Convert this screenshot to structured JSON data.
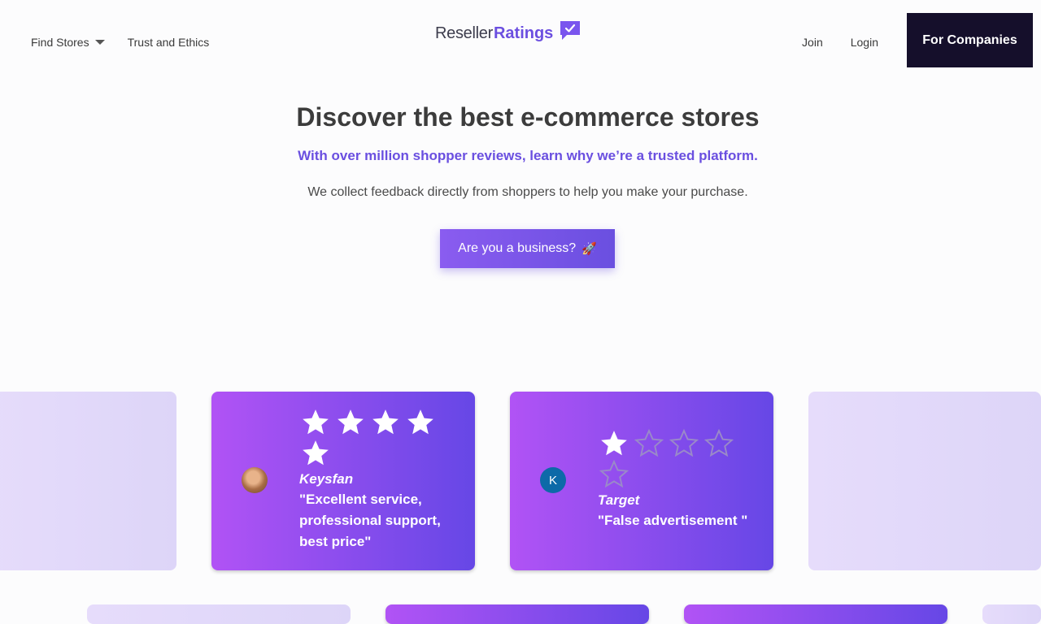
{
  "header": {
    "nav_left": [
      {
        "label": "Find Stores"
      },
      {
        "label": "Trust and Ethics"
      }
    ],
    "logo": {
      "part1": "Reseller",
      "part2": "Ratings"
    },
    "join_label": "Join",
    "login_label": "Login",
    "companies_label": "For Companies"
  },
  "hero": {
    "title": "Discover the best e-commerce stores",
    "subtitle": "With over million shopper reviews, learn why we’re a trusted platform.",
    "description": "We collect feedback directly from shoppers to help you make your purchase.",
    "cta_label": "Are you a business?",
    "cta_emoji": "🚀"
  },
  "reviews": [
    {
      "reviewer": "Keysfan",
      "rating": 5,
      "quote": "\"Excellent service, professional support, best price\""
    },
    {
      "reviewer": "Target",
      "rating": 1,
      "avatar_letter": "K",
      "quote": "\"False advertisement \""
    }
  ],
  "colors": {
    "accent": "#6a4fe0",
    "dark": "#150f2b",
    "card_gradient_start": "#b153f5",
    "card_gradient_end": "#6647e6"
  }
}
